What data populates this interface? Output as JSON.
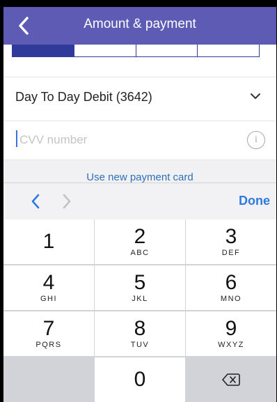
{
  "navbar": {
    "title": "Amount & payment"
  },
  "account": {
    "selected": "Day To Day Debit (3642)"
  },
  "cvv": {
    "placeholder": "CVV number",
    "value": ""
  },
  "links": {
    "new_card": "Use new payment card"
  },
  "toolbar": {
    "done_label": "Done"
  },
  "keypad": {
    "keys": [
      {
        "digit": "1",
        "letters": ""
      },
      {
        "digit": "2",
        "letters": "ABC"
      },
      {
        "digit": "3",
        "letters": "DEF"
      },
      {
        "digit": "4",
        "letters": "GHI"
      },
      {
        "digit": "5",
        "letters": "JKL"
      },
      {
        "digit": "6",
        "letters": "MNO"
      },
      {
        "digit": "7",
        "letters": "PQRS"
      },
      {
        "digit": "8",
        "letters": "TUV"
      },
      {
        "digit": "9",
        "letters": "WXYZ"
      },
      {
        "digit": "0",
        "letters": ""
      }
    ]
  },
  "colors": {
    "navbar": "#5d5bb4",
    "segment": "#2f3a9a",
    "link": "#2e6fb9",
    "done": "#2e7ae0"
  }
}
